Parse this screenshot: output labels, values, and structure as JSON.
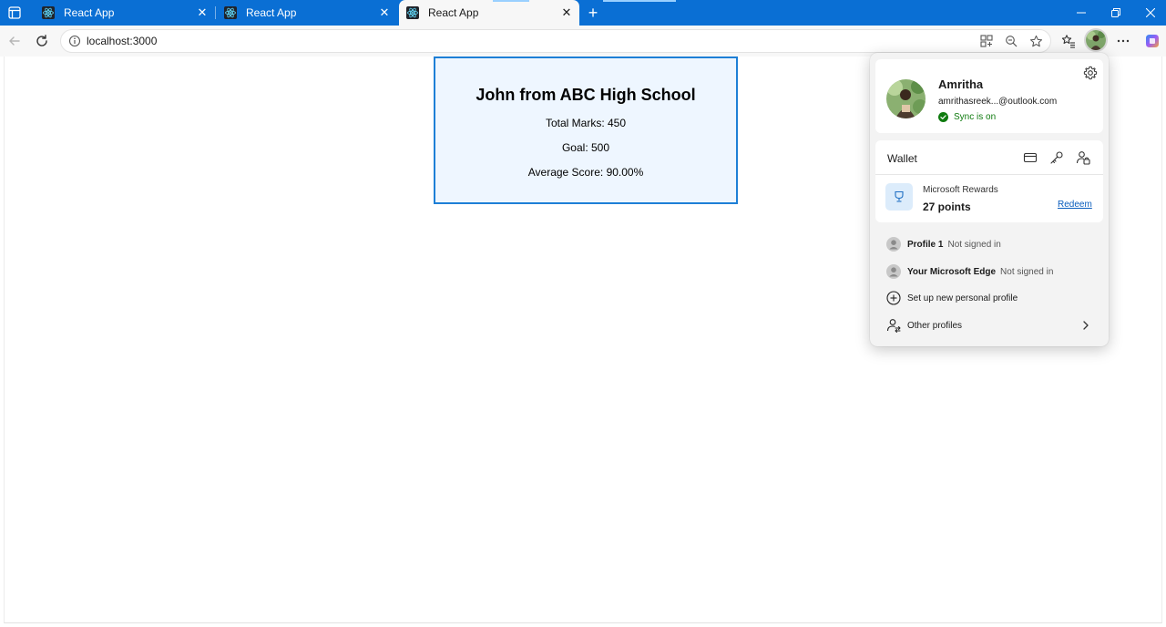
{
  "browser": {
    "tabs": [
      {
        "title": "React App"
      },
      {
        "title": "React App"
      },
      {
        "title": "React App"
      }
    ],
    "address": "localhost:3000",
    "colors": {
      "titlebar": "#0a6fd4",
      "toolbar": "#f7f7f7"
    }
  },
  "page": {
    "heading": "John from ABC High School",
    "total_marks": "Total Marks: 450",
    "goal": "Goal: 500",
    "average": "Average Score: 90.00%"
  },
  "profile": {
    "name": "Amritha",
    "email": "amrithasreek...@outlook.com",
    "sync": "Sync is on"
  },
  "wallet": {
    "title": "Wallet",
    "rewards_label": "Microsoft Rewards",
    "rewards_points": "27 points",
    "redeem": "Redeem"
  },
  "profiles": [
    {
      "name": "Profile 1",
      "status": "Not signed in"
    },
    {
      "name": "Your Microsoft Edge",
      "status": "Not signed in"
    }
  ],
  "actions": {
    "new_profile": "Set up new personal profile",
    "other_profiles": "Other profiles"
  }
}
